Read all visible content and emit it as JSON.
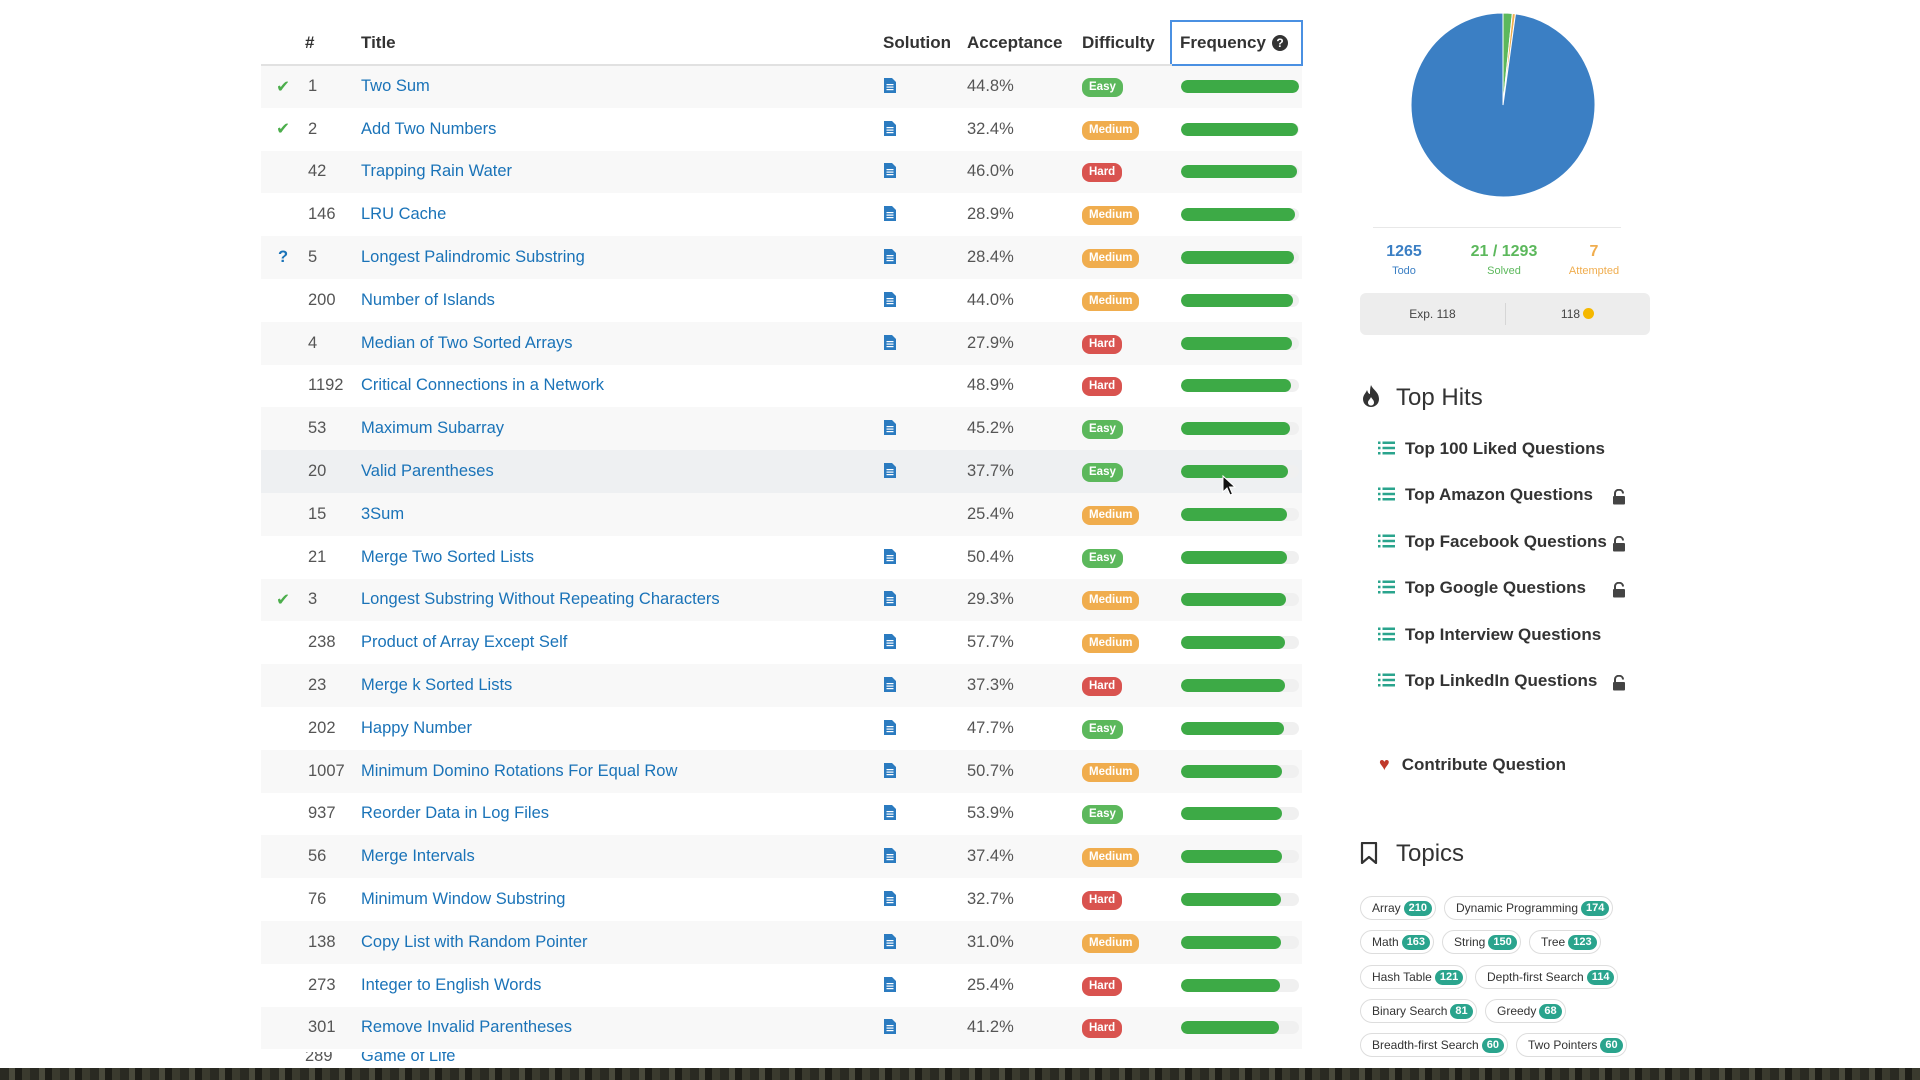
{
  "table": {
    "headers": {
      "id": "#",
      "title": "Title",
      "solution": "Solution",
      "acceptance": "Acceptance",
      "difficulty": "Difficulty",
      "frequency": "Frequency"
    },
    "rows": [
      {
        "status": "✔",
        "id": "1",
        "title": "Two Sum",
        "solution": true,
        "acceptance": "44.8%",
        "difficulty": "Easy",
        "frequency": 1.0
      },
      {
        "status": "✔",
        "id": "2",
        "title": "Add Two Numbers",
        "solution": true,
        "acceptance": "32.4%",
        "difficulty": "Medium",
        "frequency": 0.99
      },
      {
        "status": "",
        "id": "42",
        "title": "Trapping Rain Water",
        "solution": true,
        "acceptance": "46.0%",
        "difficulty": "Hard",
        "frequency": 0.98
      },
      {
        "status": "",
        "id": "146",
        "title": "LRU Cache",
        "solution": true,
        "acceptance": "28.9%",
        "difficulty": "Medium",
        "frequency": 0.97
      },
      {
        "status": "?",
        "id": "5",
        "title": "Longest Palindromic Substring",
        "solution": true,
        "acceptance": "28.4%",
        "difficulty": "Medium",
        "frequency": 0.96
      },
      {
        "status": "",
        "id": "200",
        "title": "Number of Islands",
        "solution": true,
        "acceptance": "44.0%",
        "difficulty": "Medium",
        "frequency": 0.95
      },
      {
        "status": "",
        "id": "4",
        "title": "Median of Two Sorted Arrays",
        "solution": true,
        "acceptance": "27.9%",
        "difficulty": "Hard",
        "frequency": 0.94
      },
      {
        "status": "",
        "id": "1192",
        "title": "Critical Connections in a Network",
        "solution": false,
        "acceptance": "48.9%",
        "difficulty": "Hard",
        "frequency": 0.93
      },
      {
        "status": "",
        "id": "53",
        "title": "Maximum Subarray",
        "solution": true,
        "acceptance": "45.2%",
        "difficulty": "Easy",
        "frequency": 0.92
      },
      {
        "status": "",
        "id": "20",
        "title": "Valid Parentheses",
        "solution": true,
        "acceptance": "37.7%",
        "difficulty": "Easy",
        "frequency": 0.91
      },
      {
        "status": "",
        "id": "15",
        "title": "3Sum",
        "solution": false,
        "acceptance": "25.4%",
        "difficulty": "Medium",
        "frequency": 0.9
      },
      {
        "status": "",
        "id": "21",
        "title": "Merge Two Sorted Lists",
        "solution": true,
        "acceptance": "50.4%",
        "difficulty": "Easy",
        "frequency": 0.9
      },
      {
        "status": "✔",
        "id": "3",
        "title": "Longest Substring Without Repeating Characters",
        "solution": true,
        "acceptance": "29.3%",
        "difficulty": "Medium",
        "frequency": 0.89
      },
      {
        "status": "",
        "id": "238",
        "title": "Product of Array Except Self",
        "solution": true,
        "acceptance": "57.7%",
        "difficulty": "Medium",
        "frequency": 0.88
      },
      {
        "status": "",
        "id": "23",
        "title": "Merge k Sorted Lists",
        "solution": true,
        "acceptance": "37.3%",
        "difficulty": "Hard",
        "frequency": 0.88
      },
      {
        "status": "",
        "id": "202",
        "title": "Happy Number",
        "solution": true,
        "acceptance": "47.7%",
        "difficulty": "Easy",
        "frequency": 0.87
      },
      {
        "status": "",
        "id": "1007",
        "title": "Minimum Domino Rotations For Equal Row",
        "solution": true,
        "acceptance": "50.7%",
        "difficulty": "Medium",
        "frequency": 0.86
      },
      {
        "status": "",
        "id": "937",
        "title": "Reorder Data in Log Files",
        "solution": true,
        "acceptance": "53.9%",
        "difficulty": "Easy",
        "frequency": 0.86
      },
      {
        "status": "",
        "id": "56",
        "title": "Merge Intervals",
        "solution": true,
        "acceptance": "37.4%",
        "difficulty": "Medium",
        "frequency": 0.86
      },
      {
        "status": "",
        "id": "76",
        "title": "Minimum Window Substring",
        "solution": true,
        "acceptance": "32.7%",
        "difficulty": "Hard",
        "frequency": 0.85
      },
      {
        "status": "",
        "id": "138",
        "title": "Copy List with Random Pointer",
        "solution": true,
        "acceptance": "31.0%",
        "difficulty": "Medium",
        "frequency": 0.85
      },
      {
        "status": "",
        "id": "273",
        "title": "Integer to English Words",
        "solution": true,
        "acceptance": "25.4%",
        "difficulty": "Hard",
        "frequency": 0.84
      },
      {
        "status": "",
        "id": "301",
        "title": "Remove Invalid Parentheses",
        "solution": true,
        "acceptance": "41.2%",
        "difficulty": "Hard",
        "frequency": 0.83
      }
    ]
  },
  "difficulty_colors": {
    "Easy": "#5cb85c",
    "Medium": "#f0ad4e",
    "Hard": "#d9534f"
  },
  "progress": {
    "todo": "1265",
    "todo_label": "Todo",
    "solved": "21 / 1293",
    "solved_label": "Solved",
    "attempted": "7",
    "attempted_label": "Attempted",
    "colors": {
      "todo": "#3b7fc4",
      "solved": "#5cb85c",
      "attempted": "#f0ad4e"
    },
    "pie": {
      "todo": 1265,
      "solved": 21,
      "attempted": 7
    }
  },
  "exp": {
    "left": "Exp. 118",
    "right": "118"
  },
  "top_hits": {
    "title": "Top Hits",
    "items": [
      {
        "label": "Top 100 Liked Questions",
        "locked": false
      },
      {
        "label": "Top Amazon Questions",
        "locked": true
      },
      {
        "label": "Top Facebook Questions",
        "locked": true
      },
      {
        "label": "Top Google Questions",
        "locked": true
      },
      {
        "label": "Top Interview Questions",
        "locked": false
      },
      {
        "label": "Top LinkedIn Questions",
        "locked": true
      }
    ],
    "contribute": "Contribute Question"
  },
  "topics": {
    "title": "Topics",
    "tags": [
      {
        "name": "Array",
        "count": "210"
      },
      {
        "name": "Dynamic Programming",
        "count": "174"
      },
      {
        "name": "Math",
        "count": "163"
      },
      {
        "name": "String",
        "count": "150"
      },
      {
        "name": "Tree",
        "count": "123"
      },
      {
        "name": "Hash Table",
        "count": "121"
      },
      {
        "name": "Depth-first Search",
        "count": "114"
      },
      {
        "name": "Binary Search",
        "count": "81"
      },
      {
        "name": "Greedy",
        "count": "68"
      },
      {
        "name": "Breadth-first Search",
        "count": "60"
      },
      {
        "name": "Two Pointers",
        "count": "60"
      }
    ]
  }
}
